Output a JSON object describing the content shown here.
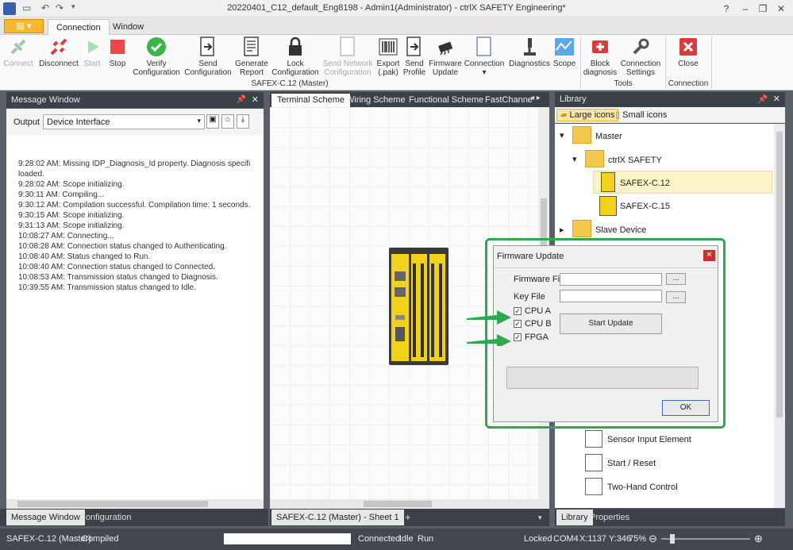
{
  "window": {
    "title": "20220401_C12_default_Eng8198 - Admin1(Administrator) - ctrlX SAFETY Engineering*",
    "minimize": "–",
    "restore": "❐",
    "close": "✕",
    "help": "?"
  },
  "ribbon_tabs": [
    "Connection",
    "Window"
  ],
  "ribbon": {
    "buttons": [
      {
        "label": "Connect",
        "label2": ""
      },
      {
        "label": "Disconnect",
        "label2": ""
      },
      {
        "label": "Start",
        "label2": ""
      },
      {
        "label": "Stop",
        "label2": ""
      },
      {
        "label": "Verify",
        "label2": "Configuration"
      },
      {
        "label": "Send",
        "label2": "Configuration"
      },
      {
        "label": "Generate",
        "label2": "Report"
      },
      {
        "label": "Lock",
        "label2": "Configuration"
      },
      {
        "label": "Send Network",
        "label2": "Configuration"
      },
      {
        "label": "Export",
        "label2": "(.pak)"
      },
      {
        "label": "Send",
        "label2": "Profile"
      },
      {
        "label": "Firmware",
        "label2": "Update"
      },
      {
        "label": "Connection",
        "label2": "▾"
      },
      {
        "label": "Diagnostics",
        "label2": ""
      },
      {
        "label": "Scope",
        "label2": ""
      },
      {
        "label": "Block",
        "label2": "diagnosis"
      },
      {
        "label": "Connection",
        "label2": "Settings"
      },
      {
        "label": "Close",
        "label2": ""
      }
    ],
    "group_labels": {
      "main": "SAFEX-C.12 (Master)",
      "tools": "Tools",
      "connection": "Connection"
    }
  },
  "message_window": {
    "title": "Message Window",
    "output_label": "Output",
    "output_value": "Device Interface",
    "lines": [
      "9:28:02  AM:      Missing  IDP_Diagnosis_Id  property.  Diagnosis  specifi",
      "loaded.",
      "9:28:02 AM:  Scope initializing.",
      "9:30:11 AM:  Compiling...",
      "9:30:12 AM:  Compilation successful. Compilation time: 1 seconds.",
      "9:30:15 AM:  Scope initializing.",
      "9:31:13 AM:  Scope initializing.",
      "10:08:27 AM:  Connecting...",
      "10:08:28 AM:  Connection status changed to Authenticating.",
      "10:08:40 AM:  Status changed to Run.",
      "10:08:40 AM:  Connection status changed to Connected.",
      "10:08:53 AM:  Transmission status changed to Diagnosis.",
      "10:39:55 AM:  Transmission status changed to Idle."
    ],
    "tabs": [
      "Message Window",
      "Configuration"
    ]
  },
  "doc_tabs": [
    "Terminal Scheme",
    "Wiring Scheme",
    "Functional Scheme",
    "FastChanne"
  ],
  "sheet_tab": "SAFEX-C.12 (Master) - Sheet 1",
  "sheet_add": "+",
  "library": {
    "title": "Library",
    "large_icons": "Large icons",
    "small_icons": "Small icons",
    "tree": [
      {
        "label": "Master"
      },
      {
        "label": "ctrlX SAFETY"
      },
      {
        "label": "SAFEX-C.12"
      },
      {
        "label": "SAFEX-C.15"
      },
      {
        "label": "Slave Device"
      },
      {
        "label": "Sensor Input Element"
      },
      {
        "label": "Start / Reset"
      },
      {
        "label": "Two-Hand Control"
      }
    ],
    "tabs": [
      "Library",
      "Properties"
    ]
  },
  "dialog": {
    "title": "Firmware Update",
    "firmware_file_label": "Firmware File",
    "key_file_label": "Key File",
    "browse": "...",
    "checks": [
      "CPU A",
      "CPU B",
      "FPGA"
    ],
    "start_update": "Start Update",
    "ok": "OK"
  },
  "status": {
    "device": "SAFEX-C.12 (Master)",
    "compiled": "Compiled",
    "connected": "Connected",
    "idle": "Idle",
    "run": "Run",
    "locked": "Locked",
    "port": "COM4",
    "coords": "X:1137 Y:346",
    "zoom": "75%"
  },
  "colors": {
    "highlight": "#2fa84f",
    "accent": "#f5b82e",
    "panel": "#3c4148"
  }
}
